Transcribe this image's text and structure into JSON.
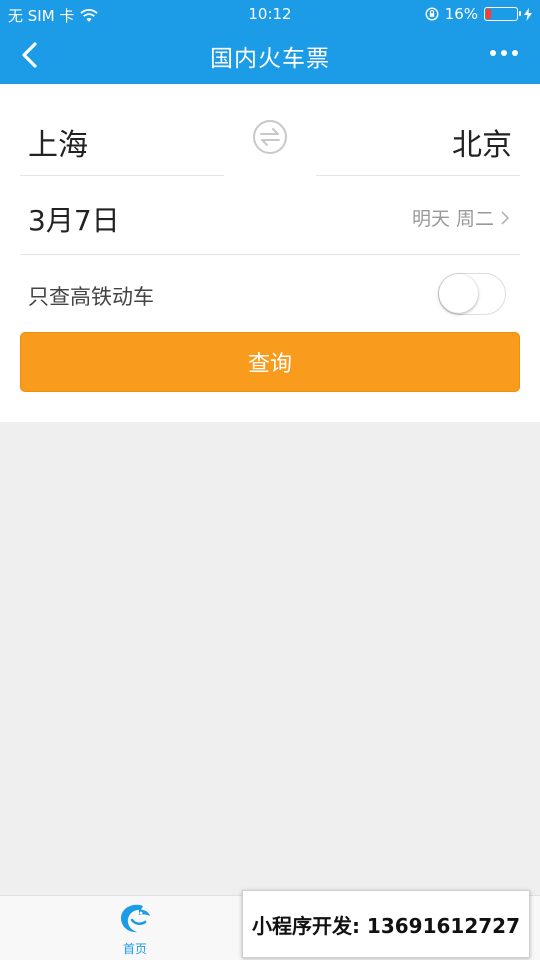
{
  "status_bar": {
    "carrier": "无 SIM 卡",
    "time": "10:12",
    "battery": "16%",
    "battery_level": 0.16
  },
  "nav": {
    "title": "国内火车票"
  },
  "search": {
    "from_station": "上海",
    "to_station": "北京",
    "date": "3月7日",
    "day_info": "明天 周二",
    "high_speed_label": "只查高铁动车",
    "high_speed_on": false,
    "query_button": "查询"
  },
  "tabbar": {
    "home_label": "首页"
  },
  "promo": {
    "text": "小程序开发: 13691612727"
  },
  "colors": {
    "primary": "#1c9be6",
    "accent": "#f99b1c",
    "background": "#efefef"
  },
  "icons": {
    "back": "chevron-left-icon",
    "more": "more-icon",
    "swap": "swap-icon",
    "chevron": "chevron-right-icon",
    "wifi": "wifi-icon",
    "lock": "rotation-lock-icon",
    "charging": "charging-icon",
    "home": "dolphin-logo-icon"
  }
}
